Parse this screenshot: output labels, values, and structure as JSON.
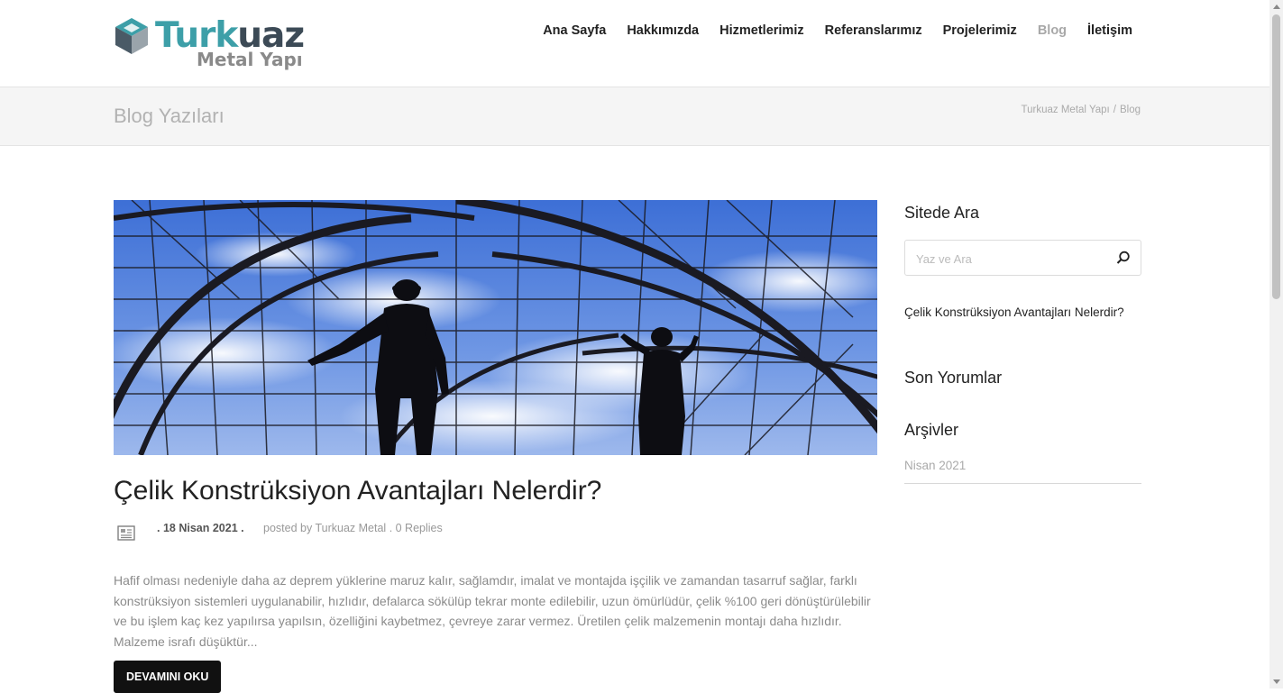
{
  "header": {
    "logo": {
      "text_primary_a": "Turk",
      "text_primary_b": "uaz",
      "text_secondary": "Metal Yapı"
    },
    "nav": [
      {
        "label": "Ana Sayfa",
        "active": false
      },
      {
        "label": "Hakkımızda",
        "active": false
      },
      {
        "label": "Hizmetlerimiz",
        "active": false
      },
      {
        "label": "Referanslarımız",
        "active": false
      },
      {
        "label": "Projelerimiz",
        "active": false
      },
      {
        "label": "Blog",
        "active": true
      },
      {
        "label": "İletişim",
        "active": false
      }
    ]
  },
  "title_bar": {
    "title": "Blog Yazıları",
    "breadcrumb": {
      "home": "Turkuaz Metal Yapı",
      "separator": "/",
      "current": "Blog"
    }
  },
  "post": {
    "title": "Çelik Konstrüksiyon Avantajları Nelerdir?",
    "date": ". 18 Nisan 2021 .",
    "posted_by_label": "posted by",
    "author": "Turkuaz Metal",
    "replies": ". 0 Replies",
    "excerpt": "Hafif olması nedeniyle daha az deprem yüklerine maruz kalır, sağlamdır, imalat ve montajda işçilik ve zamandan tasarruf sağlar, farklı konstrüksiyon sistemleri uygulanabilir, hızlıdır, defalarca sökülüp tekrar monte edilebilir, uzun ömürlüdür, çelik %100 geri dönüştürülebilir ve bu işlem kaç kez yapılırsa yapılsın, özelliğini kaybetmez, çevreye zarar vermez. Üretilen çelik malzemenin montajı daha hızlıdır. Malzeme israfı düşüktür...",
    "read_more": "DEVAMINI OKU"
  },
  "sidebar": {
    "search": {
      "title": "Sitede Ara",
      "placeholder": "Yaz ve Ara"
    },
    "recent_post": "Çelik Konstrüksiyon Avantajları Nelerdir?",
    "comments_title": "Son Yorumlar",
    "archives": {
      "title": "Arşivler",
      "items": [
        "Nisan 2021"
      ]
    }
  },
  "icons": {
    "logo": "logo-cube-icon",
    "post_format": "document-icon",
    "search": "search-icon"
  },
  "colors": {
    "brand_turquoise": "#3d9fa8",
    "brand_dark": "#3c4a56",
    "nav_active": "#a8a8a8",
    "button_bg": "#111111"
  }
}
